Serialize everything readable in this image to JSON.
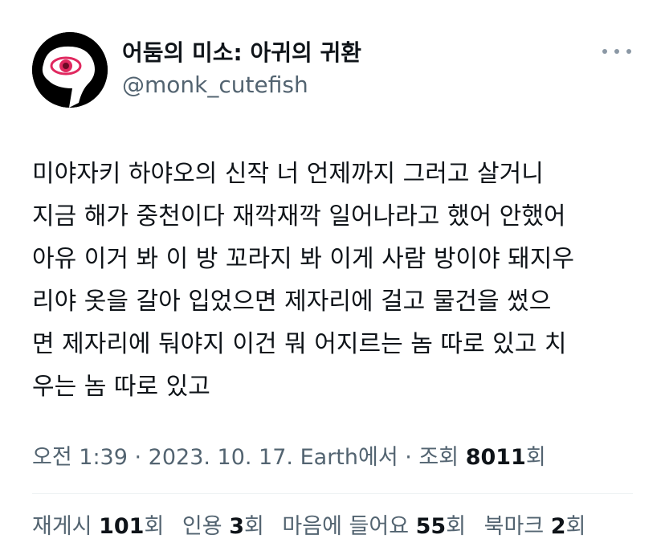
{
  "author": {
    "display_name": "어둠의 미소: 아귀의 귀환",
    "handle": "@monk_cutefish",
    "avatar_icon": "eye-icon"
  },
  "more_icon": "more-dots-icon",
  "tweet": {
    "lines": [
      "미야자키 하야오의 신작 너 언제까지 그러고 살거니",
      "지금 해가 중천이다 재깍재깍 일어나라고 했어 안했어",
      "아유 이거 봐 이 방 꼬라지 봐 이게 사람 방이야 돼지우",
      "리야 옷을 갈아 입었으면 제자리에 걸고 물건을 썼으",
      "면 제자리에 둬야지 이건 뭐 어지르는 놈 따로 있고 치",
      "우는 놈 따로 있고"
    ]
  },
  "meta": {
    "time": "오전 1:39",
    "sep1": " · ",
    "date": "2023. 10. 17.",
    "source": " Earth에서",
    "sep2": " · ",
    "views_label": "조회 ",
    "views_count": "8011",
    "views_suffix": "회"
  },
  "stats": {
    "retweets_label": "재게시 ",
    "retweets_count": "101",
    "retweets_suffix": "회",
    "quotes_label": "인용 ",
    "quotes_count": "3",
    "quotes_suffix": "회",
    "likes_label": "마음에 들어요 ",
    "likes_count": "55",
    "likes_suffix": "회",
    "bookmarks_label": "북마크 ",
    "bookmarks_count": "2",
    "bookmarks_suffix": "회"
  },
  "colors": {
    "text": "#0f1419",
    "secondary": "#536471",
    "avatar_bg": "#000000",
    "eye_red": "#e0285f"
  }
}
